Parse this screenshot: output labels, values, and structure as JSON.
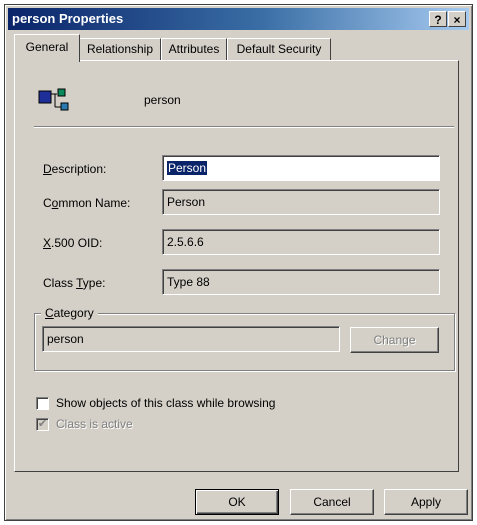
{
  "window": {
    "title": "person Properties",
    "help_button": "?",
    "close_button": "×"
  },
  "tabs": [
    {
      "label": "General",
      "active": true
    },
    {
      "label": "Relationship",
      "active": false
    },
    {
      "label": "Attributes",
      "active": false
    },
    {
      "label": "Default Security",
      "active": false
    }
  ],
  "header": {
    "icon": "class-schema-icon",
    "name": "person"
  },
  "fields": {
    "description": {
      "label": "Description:",
      "value": "Person"
    },
    "common_name": {
      "label": "Common Name:",
      "value": "Person"
    },
    "oid": {
      "label": "X.500 OID:",
      "value": "2.5.6.6"
    },
    "class_type": {
      "label": "Class Type:",
      "value": "Type 88"
    }
  },
  "category": {
    "group_label": "Category",
    "value": "person",
    "change_button": "Change"
  },
  "checkboxes": {
    "show_objects": {
      "label": "Show objects of this class while browsing",
      "checked": false
    },
    "class_active": {
      "label": "Class is active",
      "checked": true,
      "disabled": true
    }
  },
  "buttons": {
    "ok": "OK",
    "cancel": "Cancel",
    "apply": "Apply"
  },
  "colors": {
    "title_bar_start": "#0a246a",
    "title_bar_end": "#a6caf0",
    "dialog_face": "#d4d0c8",
    "selection": "#0a246a"
  }
}
